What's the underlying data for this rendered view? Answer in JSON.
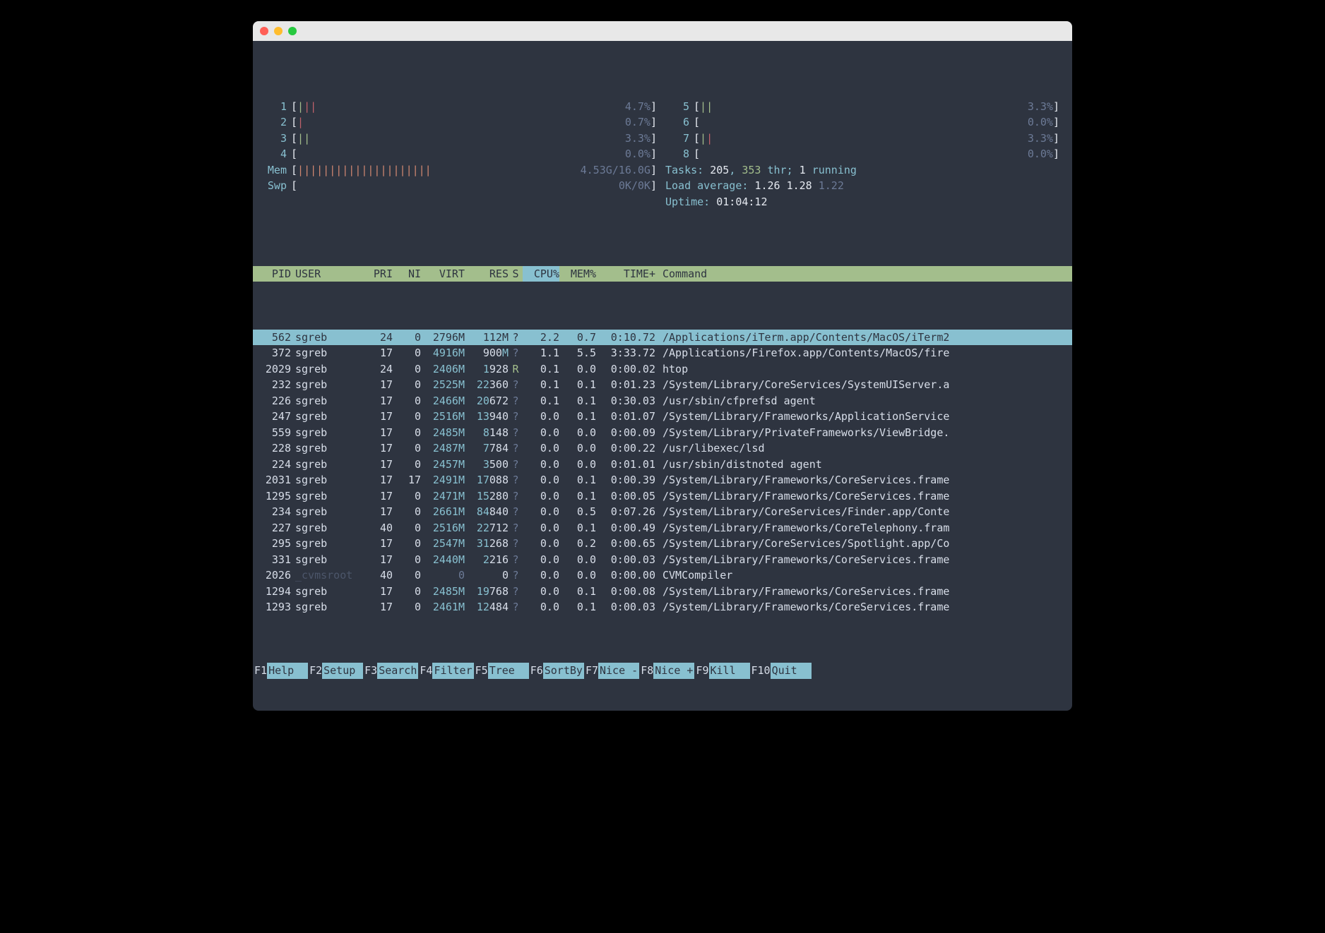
{
  "cpu_meters_left": [
    {
      "id": "1",
      "bars": "|||",
      "bar_colors": [
        "#a3be8c",
        "#bf616a",
        "#bf616a"
      ],
      "pct": "4.7%"
    },
    {
      "id": "2",
      "bars": "|",
      "bar_colors": [
        "#bf616a"
      ],
      "pct": "0.7%"
    },
    {
      "id": "3",
      "bars": "||",
      "bar_colors": [
        "#a3be8c",
        "#a3be8c"
      ],
      "pct": "3.3%"
    },
    {
      "id": "4",
      "bars": "",
      "bar_colors": [],
      "pct": "0.0%"
    }
  ],
  "cpu_meters_right": [
    {
      "id": "5",
      "bars": "||",
      "bar_colors": [
        "#a3be8c",
        "#a3be8c"
      ],
      "pct": "3.3%"
    },
    {
      "id": "6",
      "bars": "",
      "bar_colors": [],
      "pct": "0.0%"
    },
    {
      "id": "7",
      "bars": "||",
      "bar_colors": [
        "#a3be8c",
        "#bf616a"
      ],
      "pct": "3.3%"
    },
    {
      "id": "8",
      "bars": "",
      "bar_colors": [],
      "pct": "0.0%"
    }
  ],
  "mem": {
    "label": "Mem",
    "bars": "|||||||||||||||||||||",
    "value": "4.53G/16.0G"
  },
  "swp": {
    "label": "Swp",
    "bars": "",
    "value": "0K/0K"
  },
  "tasks": {
    "label": "Tasks:",
    "count": "205",
    "threads": "353",
    "threads_label": "thr;",
    "running": "1",
    "running_label": "running"
  },
  "load": {
    "label": "Load average:",
    "a": "1.26",
    "b": "1.28",
    "c": "1.22"
  },
  "uptime": {
    "label": "Uptime:",
    "value": "01:04:12"
  },
  "columns": {
    "pid": "PID",
    "user": "USER",
    "pri": "PRI",
    "ni": "NI",
    "virt": "VIRT",
    "res": "RES",
    "s": "S",
    "cpu": "CPU%",
    "mem": "MEM%",
    "time": "TIME+",
    "cmd": "Command"
  },
  "rows": [
    {
      "pid": "562",
      "user": "sgreb",
      "pri": "24",
      "ni": "0",
      "virt": "2796M",
      "res": "112M",
      "s": "?",
      "cpu": "2.2",
      "mem": "0.7",
      "time": "0:10.72",
      "cmd": "/Applications/iTerm.app/Contents/MacOS/iTerm2",
      "sel": true
    },
    {
      "pid": "372",
      "user": "sgreb",
      "pri": "17",
      "ni": "0",
      "virt": "4916M",
      "res": "900M",
      "s": "?",
      "cpu": "1.1",
      "mem": "5.5",
      "time": "3:33.72",
      "cmd": "/Applications/Firefox.app/Contents/MacOS/fire"
    },
    {
      "pid": "2029",
      "user": "sgreb",
      "pri": "24",
      "ni": "0",
      "virt": "2406M",
      "res": "1928",
      "s": "R",
      "cpu": "0.1",
      "mem": "0.0",
      "time": "0:00.02",
      "cmd": "htop"
    },
    {
      "pid": "232",
      "user": "sgreb",
      "pri": "17",
      "ni": "0",
      "virt": "2525M",
      "res": "22360",
      "s": "?",
      "cpu": "0.1",
      "mem": "0.1",
      "time": "0:01.23",
      "cmd": "/System/Library/CoreServices/SystemUIServer.a"
    },
    {
      "pid": "226",
      "user": "sgreb",
      "pri": "17",
      "ni": "0",
      "virt": "2466M",
      "res": "20672",
      "s": "?",
      "cpu": "0.1",
      "mem": "0.1",
      "time": "0:30.03",
      "cmd": "/usr/sbin/cfprefsd agent"
    },
    {
      "pid": "247",
      "user": "sgreb",
      "pri": "17",
      "ni": "0",
      "virt": "2516M",
      "res": "13940",
      "s": "?",
      "cpu": "0.0",
      "mem": "0.1",
      "time": "0:01.07",
      "cmd": "/System/Library/Frameworks/ApplicationService"
    },
    {
      "pid": "559",
      "user": "sgreb",
      "pri": "17",
      "ni": "0",
      "virt": "2485M",
      "res": "8148",
      "s": "?",
      "cpu": "0.0",
      "mem": "0.0",
      "time": "0:00.09",
      "cmd": "/System/Library/PrivateFrameworks/ViewBridge."
    },
    {
      "pid": "228",
      "user": "sgreb",
      "pri": "17",
      "ni": "0",
      "virt": "2487M",
      "res": "7784",
      "s": "?",
      "cpu": "0.0",
      "mem": "0.0",
      "time": "0:00.22",
      "cmd": "/usr/libexec/lsd"
    },
    {
      "pid": "224",
      "user": "sgreb",
      "pri": "17",
      "ni": "0",
      "virt": "2457M",
      "res": "3500",
      "s": "?",
      "cpu": "0.0",
      "mem": "0.0",
      "time": "0:01.01",
      "cmd": "/usr/sbin/distnoted agent"
    },
    {
      "pid": "2031",
      "user": "sgreb",
      "pri": "17",
      "ni": "17",
      "virt": "2491M",
      "res": "17088",
      "s": "?",
      "cpu": "0.0",
      "mem": "0.1",
      "time": "0:00.39",
      "cmd": "/System/Library/Frameworks/CoreServices.frame"
    },
    {
      "pid": "1295",
      "user": "sgreb",
      "pri": "17",
      "ni": "0",
      "virt": "2471M",
      "res": "15280",
      "s": "?",
      "cpu": "0.0",
      "mem": "0.1",
      "time": "0:00.05",
      "cmd": "/System/Library/Frameworks/CoreServices.frame"
    },
    {
      "pid": "234",
      "user": "sgreb",
      "pri": "17",
      "ni": "0",
      "virt": "2661M",
      "res": "84840",
      "s": "?",
      "cpu": "0.0",
      "mem": "0.5",
      "time": "0:07.26",
      "cmd": "/System/Library/CoreServices/Finder.app/Conte"
    },
    {
      "pid": "227",
      "user": "sgreb",
      "pri": "40",
      "ni": "0",
      "virt": "2516M",
      "res": "22712",
      "s": "?",
      "cpu": "0.0",
      "mem": "0.1",
      "time": "0:00.49",
      "cmd": "/System/Library/Frameworks/CoreTelephony.fram"
    },
    {
      "pid": "295",
      "user": "sgreb",
      "pri": "17",
      "ni": "0",
      "virt": "2547M",
      "res": "31268",
      "s": "?",
      "cpu": "0.0",
      "mem": "0.2",
      "time": "0:00.65",
      "cmd": "/System/Library/CoreServices/Spotlight.app/Co"
    },
    {
      "pid": "331",
      "user": "sgreb",
      "pri": "17",
      "ni": "0",
      "virt": "2440M",
      "res": "2216",
      "s": "?",
      "cpu": "0.0",
      "mem": "0.0",
      "time": "0:00.03",
      "cmd": "/System/Library/Frameworks/CoreServices.frame"
    },
    {
      "pid": "2026",
      "user": "_cvmsroot",
      "pri": "40",
      "ni": "0",
      "virt": "0",
      "res": "0",
      "s": "?",
      "cpu": "0.0",
      "mem": "0.0",
      "time": "0:00.00",
      "cmd": "CVMCompiler",
      "dimuser": true,
      "novirt": true
    },
    {
      "pid": "1294",
      "user": "sgreb",
      "pri": "17",
      "ni": "0",
      "virt": "2485M",
      "res": "19768",
      "s": "?",
      "cpu": "0.0",
      "mem": "0.1",
      "time": "0:00.08",
      "cmd": "/System/Library/Frameworks/CoreServices.frame"
    },
    {
      "pid": "1293",
      "user": "sgreb",
      "pri": "17",
      "ni": "0",
      "virt": "2461M",
      "res": "12484",
      "s": "?",
      "cpu": "0.0",
      "mem": "0.1",
      "time": "0:00.03",
      "cmd": "/System/Library/Frameworks/CoreServices.frame"
    }
  ],
  "fkeys": [
    {
      "k": "F1",
      "l": "Help"
    },
    {
      "k": "F2",
      "l": "Setup"
    },
    {
      "k": "F3",
      "l": "Search"
    },
    {
      "k": "F4",
      "l": "Filter"
    },
    {
      "k": "F5",
      "l": "Tree"
    },
    {
      "k": "F6",
      "l": "SortBy"
    },
    {
      "k": "F7",
      "l": "Nice -"
    },
    {
      "k": "F8",
      "l": "Nice +"
    },
    {
      "k": "F9",
      "l": "Kill"
    },
    {
      "k": "F10",
      "l": "Quit"
    }
  ]
}
